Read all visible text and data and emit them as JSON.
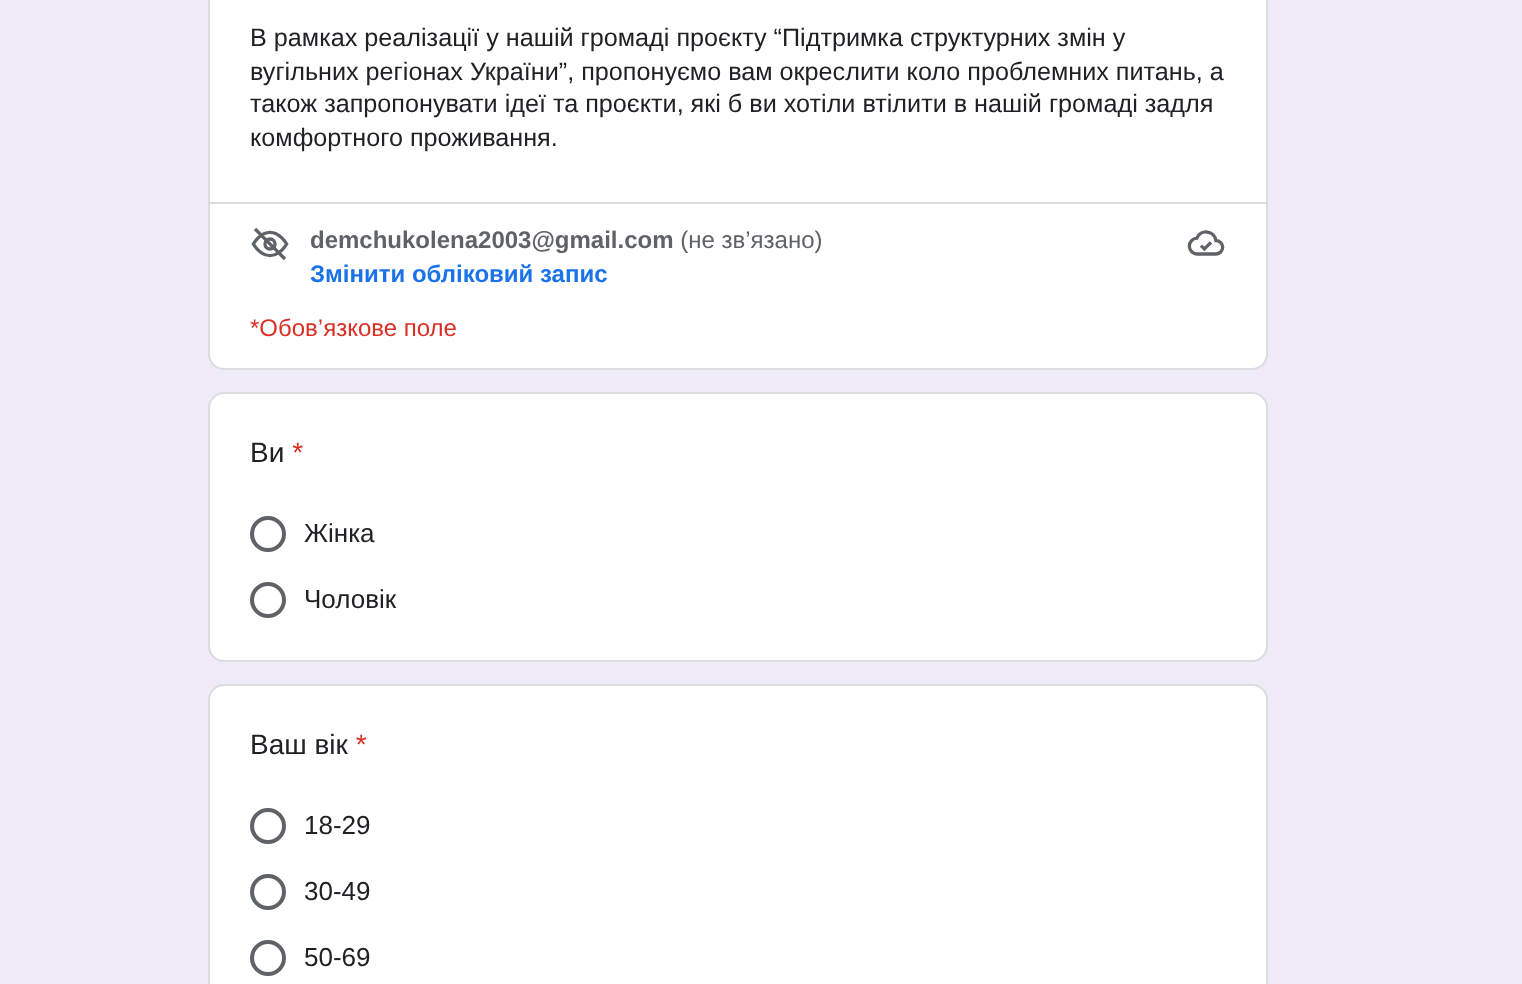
{
  "header": {
    "description": "В рамках реалізації у нашій громаді проєкту “Підтримка структурних змін у вугільних регіонах України”, пропонуємо вам окреслити коло проблемних питань, а також запропонувати ідеї та проєкти, які б ви хотіли втілити в нашій громаді задля комфортного проживання.",
    "account_email": "demchukolena2003@gmail.com",
    "account_status": "(не зв’язано)",
    "switch_account": "Змінити обліковий запис",
    "required_note": "*Обов’язкове поле"
  },
  "questions": [
    {
      "title": "Ви",
      "required_mark": "*",
      "options": [
        {
          "label": "Жінка",
          "selected": false
        },
        {
          "label": "Чоловік",
          "selected": false
        }
      ]
    },
    {
      "title": "Ваш вік",
      "required_mark": "*",
      "options": [
        {
          "label": "18-29",
          "selected": false
        },
        {
          "label": "30-49",
          "selected": false
        },
        {
          "label": "50-69",
          "selected": false
        }
      ]
    }
  ]
}
